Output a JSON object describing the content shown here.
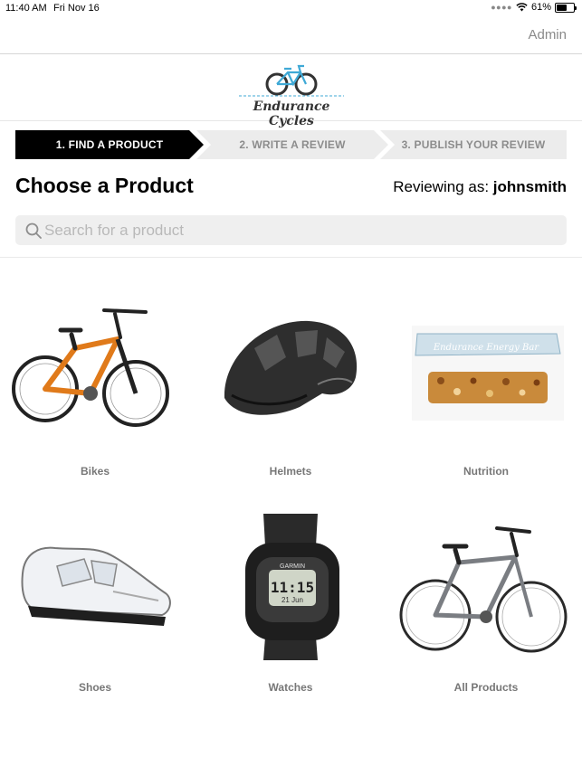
{
  "status_bar": {
    "time": "11:40 AM",
    "date": "Fri Nov 16",
    "battery": "61%",
    "battery_level": 0.61
  },
  "nav": {
    "admin_label": "Admin"
  },
  "logo": {
    "text": "Endurance Cycles"
  },
  "steps": [
    {
      "label": "1. FIND A PRODUCT",
      "active": true
    },
    {
      "label": "2. WRITE A REVIEW",
      "active": false
    },
    {
      "label": "3. PUBLISH YOUR REVIEW",
      "active": false
    }
  ],
  "page": {
    "title": "Choose a Product",
    "reviewing_prefix": "Reviewing as: ",
    "username": "johnsmith"
  },
  "search": {
    "placeholder": "Search for a product",
    "value": ""
  },
  "energy_bar_text": "Endurance Energy Bar",
  "watch_brand": "GARMIN",
  "watch_time": "11:15",
  "watch_date": "21 Jun",
  "products": [
    {
      "label": "Bikes",
      "icon": "mountain-bike-image"
    },
    {
      "label": "Helmets",
      "icon": "helmet-image"
    },
    {
      "label": "Nutrition",
      "icon": "energy-bar-image"
    },
    {
      "label": "Shoes",
      "icon": "cycling-shoe-image"
    },
    {
      "label": "Watches",
      "icon": "gps-watch-image"
    },
    {
      "label": "All Products",
      "icon": "hybrid-bike-image"
    }
  ],
  "colors": {
    "active_step": "#000000",
    "inactive_step": "#ececec",
    "bike_accent": "#e07a1a",
    "logo_accent": "#3fa9d6"
  }
}
